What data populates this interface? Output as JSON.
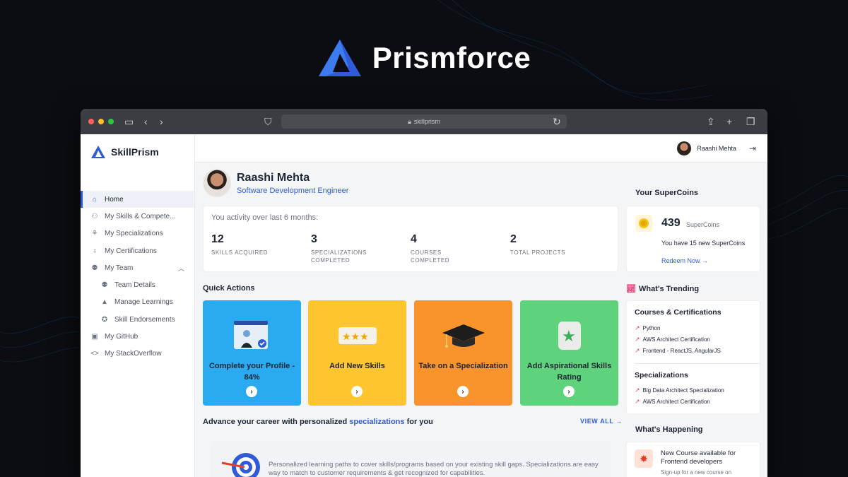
{
  "brand": {
    "name": "Prismforce"
  },
  "browser": {
    "url": "skillprism"
  },
  "app": {
    "name": "SkillPrism"
  },
  "sidebar": {
    "items": [
      {
        "label": "Home",
        "icon": "home-icon"
      },
      {
        "label": "My Skills & Compete...",
        "icon": "skills-icon"
      },
      {
        "label": "My Specializations",
        "icon": "specializations-icon"
      },
      {
        "label": "My Certifications",
        "icon": "certificate-icon"
      },
      {
        "label": "My Team",
        "icon": "team-icon"
      },
      {
        "label": "Team Details",
        "icon": "team-details-icon"
      },
      {
        "label": "Manage Learnings",
        "icon": "graduation-cap-icon"
      },
      {
        "label": "Skill Endorsements",
        "icon": "badge-check-icon"
      },
      {
        "label": "My GitHub",
        "icon": "github-icon"
      },
      {
        "label": "My StackOverflow",
        "icon": "code-icon"
      }
    ]
  },
  "user": {
    "name": "Raashi Mehta",
    "role": "Software Development Engineer"
  },
  "activity": {
    "title": "You activity over last 6 months:",
    "stats": [
      {
        "value": "12",
        "label": "SKILLS ACQUIRED"
      },
      {
        "value": "3",
        "label": "SPECIALIZATIONS COMPLETED"
      },
      {
        "value": "4",
        "label": "COURSES COMPLETED"
      },
      {
        "value": "2",
        "label": "TOTAL PROJECTS"
      }
    ]
  },
  "quick_actions": {
    "title": "Quick Actions",
    "items": [
      {
        "label": "Complete your Profile - 84%",
        "color": "#2aaaf0"
      },
      {
        "label": "Add New Skills",
        "color": "#fec52e"
      },
      {
        "label": "Take on a Specialization",
        "color": "#f9932b"
      },
      {
        "label": "Add Aspirational Skills Rating",
        "color": "#5fd27c"
      }
    ]
  },
  "career": {
    "title_prefix": "Advance your career with personalized ",
    "title_link": "specializations",
    "title_suffix": " for you",
    "view_all": "VIEW ALL",
    "description": "Personalized learning paths to cover skills/programs based on your existing skill gaps. Specializations are easy way to match to customer requirements & get recognized for capabilities."
  },
  "supercoins": {
    "title": "Your SuperCoins",
    "count": "439",
    "unit": "SuperCoins",
    "message": "You have 15 new SuperCoins",
    "redeem": "Redeem Now"
  },
  "trending": {
    "title": "What's Trending",
    "courses_title": "Courses & Certifications",
    "courses": [
      "Python",
      "AWS Architect Certification",
      "Frontend - ReactJS, AngularJS"
    ],
    "spec_title": "Specializations",
    "specs": [
      "Big Data Architect Specialization",
      "AWS Architect Certification"
    ]
  },
  "happening": {
    "title": "What's Happening",
    "item_title": "New Course available for Frontend developers",
    "item_sub": "Sign-up for a new course on"
  },
  "colors": {
    "accent": "#2f5bd8",
    "trend": "#e0457b"
  }
}
